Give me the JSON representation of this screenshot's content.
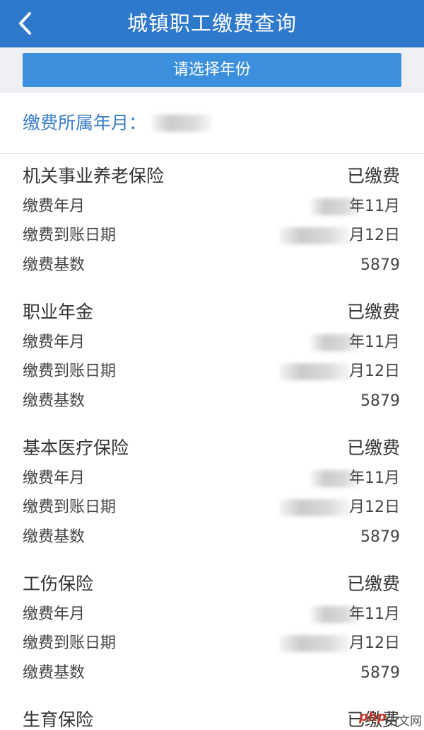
{
  "header": {
    "title": "城镇职工缴费查询",
    "back_icon": "chevron-left-icon"
  },
  "select_button": "请选择年份",
  "period": {
    "label": "缴费所属年月：",
    "value": ""
  },
  "sections": [
    {
      "name": "机关事业养老保险",
      "status": "已缴费",
      "rows": [
        {
          "label": "缴费年月",
          "value": "年11月"
        },
        {
          "label": "缴费到账日期",
          "value": "月12日"
        },
        {
          "label": "缴费基数",
          "value": "5879"
        }
      ]
    },
    {
      "name": "职业年金",
      "status": "已缴费",
      "rows": [
        {
          "label": "缴费年月",
          "value": "年11月"
        },
        {
          "label": "缴费到账日期",
          "value": "月12日"
        },
        {
          "label": "缴费基数",
          "value": "5879"
        }
      ]
    },
    {
      "name": "基本医疗保险",
      "status": "已缴费",
      "rows": [
        {
          "label": "缴费年月",
          "value": "年11月"
        },
        {
          "label": "缴费到账日期",
          "value": "月12日"
        },
        {
          "label": "缴费基数",
          "value": "5879"
        }
      ]
    },
    {
      "name": "工伤保险",
      "status": "已缴费",
      "rows": [
        {
          "label": "缴费年月",
          "value": "年11月"
        },
        {
          "label": "缴费到账日期",
          "value": "月12日"
        },
        {
          "label": "缴费基数",
          "value": "5879"
        }
      ]
    },
    {
      "name": "生育保险",
      "status": "已缴费",
      "rows": []
    }
  ],
  "watermark": {
    "brand": "php",
    "site": "中文网"
  },
  "colors": {
    "header": "#2f79cd",
    "button": "#3b8fdc",
    "period_label": "#3a7ec9"
  }
}
